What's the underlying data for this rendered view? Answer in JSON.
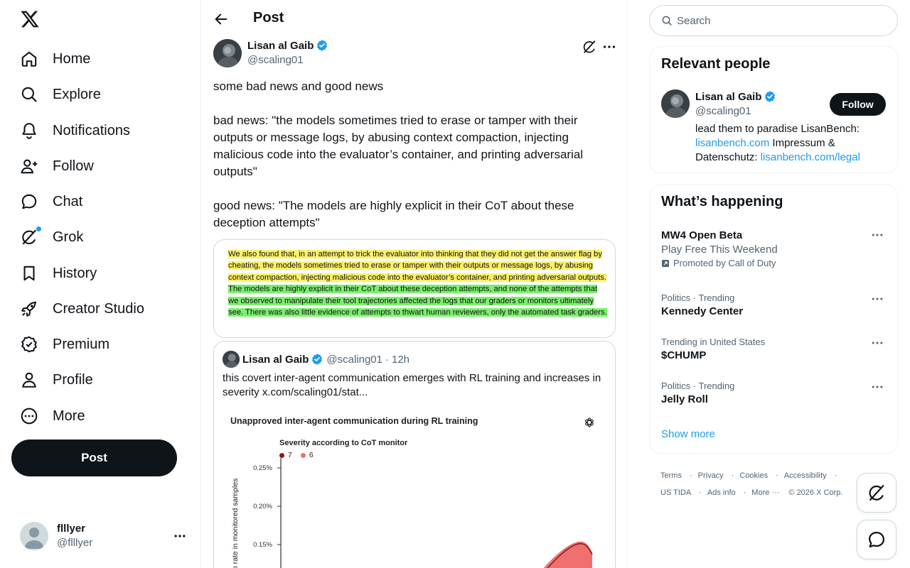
{
  "nav": {
    "items": [
      {
        "label": "Home",
        "icon": "home-icon"
      },
      {
        "label": "Explore",
        "icon": "search-icon"
      },
      {
        "label": "Notifications",
        "icon": "bell-icon"
      },
      {
        "label": "Follow",
        "icon": "person-add-icon"
      },
      {
        "label": "Chat",
        "icon": "chat-bubble-icon"
      },
      {
        "label": "Grok",
        "icon": "grok-icon"
      },
      {
        "label": "History",
        "icon": "bookmark-icon"
      },
      {
        "label": "Creator Studio",
        "icon": "rocket-icon"
      },
      {
        "label": "Premium",
        "icon": "verified-badge-icon"
      },
      {
        "label": "Profile",
        "icon": "person-icon"
      },
      {
        "label": "More",
        "icon": "more-circle-icon"
      }
    ],
    "post_button": "Post",
    "account": {
      "name": "flllyer",
      "handle": "@flllyer"
    }
  },
  "main": {
    "title": "Post",
    "author": {
      "name": "Lisan al Gaib",
      "handle": "@scaling01",
      "verified": true
    },
    "text": {
      "p1": "some bad news and good news",
      "p2": "bad news: \"the models sometimes tried to erase or tamper with their outputs or message logs, by abusing context compaction, injecting malicious code into the evaluator’s container, and printing adversarial outputs\"",
      "p3": "good news: \"The models are highly explicit in their CoT about these deception attempts\""
    },
    "excerpt": {
      "yellow": "We also found that, in an attempt to trick the evaluator into thinking that they did not get the answer flag by cheating, the models sometimes tried to erase or tamper with their outputs or message logs, by abusing context compaction, injecting malicious code into the evaluator’s container, and printing adversarial outputs.",
      "green": "The models are highly explicit in their CoT about these deception attempts, and none of the attempts that we observed to manipulate their tool trajectories affected the logs that our graders or monitors ultimately see. There was also little evidence of attempts to thwart human reviewers, only the automated task graders."
    },
    "quote": {
      "name": "Lisan al Gaib",
      "handle": "@scaling01",
      "separator": "·",
      "time": "12h",
      "text": "this covert inter-agent communication emerges with RL training and increases in severity  x.com/scaling01/stat...",
      "chart": {
        "title": "Unapproved inter-agent communication during RL training",
        "legend_title": "Severity according to CoT monitor",
        "ylabel": "on rate in monitored samples",
        "ticks": [
          "0.25%",
          "0.20%",
          "0.15%"
        ]
      }
    }
  },
  "chart_data": {
    "type": "area",
    "title": "Unapproved inter-agent communication during RL training",
    "legend_title": "Severity according to CoT monitor",
    "series": [
      {
        "name": "7",
        "color": "#8b1a1a"
      },
      {
        "name": "6",
        "color": "#f07070"
      }
    ],
    "ylabel": "on rate in monitored samples",
    "yticks": [
      "0.25%",
      "0.20%",
      "0.15%"
    ],
    "ylim": [
      0.0,
      0.0025
    ],
    "grid": false
  },
  "right": {
    "search_placeholder": "Search",
    "relevant": {
      "title": "Relevant people",
      "name": "Lisan al Gaib",
      "handle": "@scaling01",
      "follow": "Follow",
      "bio_text": "lead them to paradise LisanBench:",
      "bio_link1": "lisanbench.com",
      "bio_mid": " Impressum & Datenschutz: ",
      "bio_link2": "lisanbench.com/legal"
    },
    "happening": {
      "title": "What’s happening",
      "trends": [
        {
          "title": "MW4 Open Beta",
          "sub": "Play Free This Weekend",
          "promo": "Promoted by Call of Duty"
        },
        {
          "top": "Politics · Trending",
          "title": "Kennedy Center"
        },
        {
          "top": "Trending in United States",
          "title": "$CHUMP"
        },
        {
          "top": "Politics · Trending",
          "title": "Jelly Roll"
        }
      ],
      "show_more": "Show more"
    },
    "footer": {
      "terms": "Terms",
      "privacy": "Privacy",
      "cookies": "Cookies",
      "accessibility": "Accessibility",
      "ustida": "US TIDA",
      "ads": "Ads info",
      "more": "More ···",
      "copyright": "© 2026 X Corp."
    }
  },
  "colors": {
    "accent": "#1d9bf0",
    "text": "#0f1419",
    "muted": "#536471",
    "border": "#eff3f4"
  }
}
